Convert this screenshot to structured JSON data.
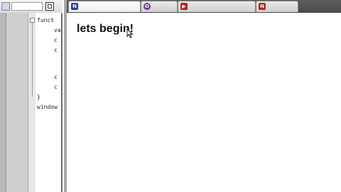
{
  "editor": {
    "gutter_icons": [
      "",
      "",
      "",
      "",
      "",
      "",
      "",
      "",
      "",
      ""
    ],
    "code_lines": [
      "funct",
      "va",
      "c",
      "c",
      "",
      "c",
      "c",
      "}",
      "window"
    ]
  },
  "browser": {
    "tabs": [
      {
        "label": "",
        "icon": "page-icon",
        "color": "#2f3f8f",
        "glyph": "N",
        "active": true
      },
      {
        "label": "",
        "icon": "circle-icon",
        "color": "#6a3a9a",
        "glyph": "O",
        "active": false
      },
      {
        "label": "",
        "icon": "video-icon",
        "color": "#c0201c",
        "glyph": "▶",
        "active": false
      },
      {
        "label": "",
        "icon": "page-icon",
        "color": "#b0281c",
        "glyph": "N",
        "active": false
      }
    ]
  },
  "page": {
    "heading": "lets begin!"
  }
}
